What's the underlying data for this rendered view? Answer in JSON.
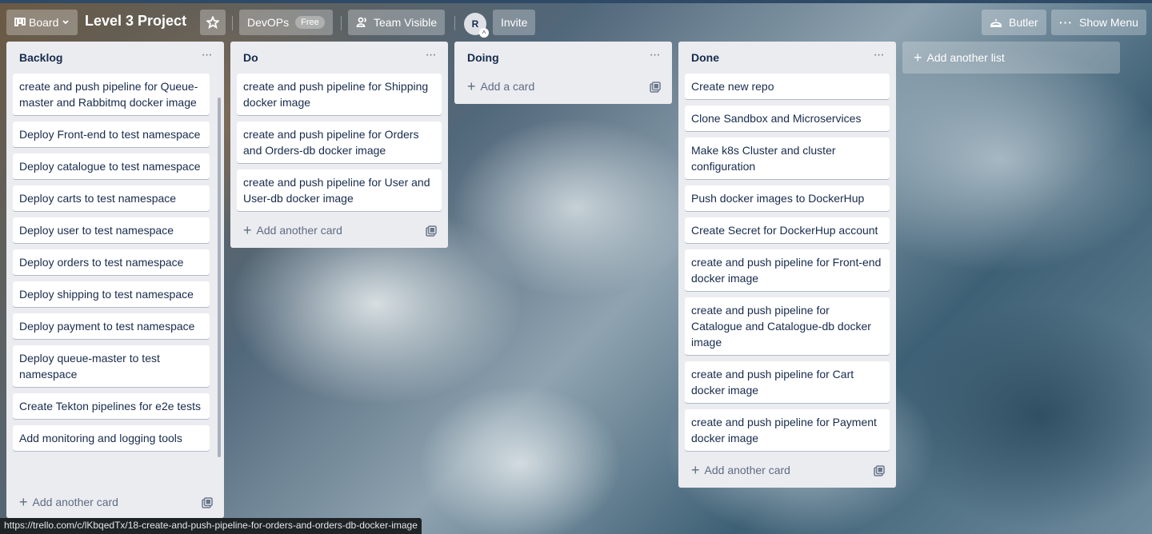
{
  "header": {
    "board_button": "Board",
    "board_title": "Level 3 Project",
    "team_name": "DevOPs",
    "team_plan": "Free",
    "visibility": "Team Visible",
    "avatar_initial": "R",
    "invite": "Invite",
    "butler": "Butler",
    "show_menu": "Show Menu"
  },
  "lists": [
    {
      "title": "Backlog",
      "cards": [
        "create and push pipeline for Queue-master and Rabbitmq docker image",
        "Deploy Front-end to test namespace",
        "Deploy catalogue to test namespace",
        "Deploy carts to test namespace",
        "Deploy user to test namespace",
        "Deploy orders to test namespace",
        "Deploy shipping to test namespace",
        "Deploy payment to test namespace",
        "Deploy queue-master to test namespace",
        "Create Tekton pipelines for e2e tests",
        "Add monitoring and logging tools"
      ],
      "add_label": "Add another card"
    },
    {
      "title": "Do",
      "cards": [
        "create and push pipeline for Shipping docker image",
        "create and push pipeline for Orders and Orders-db docker image",
        "create and push pipeline for User and User-db docker image"
      ],
      "add_label": "Add another card"
    },
    {
      "title": "Doing",
      "cards": [],
      "add_label": "Add a card"
    },
    {
      "title": "Done",
      "cards": [
        "Create new repo",
        "Clone Sandbox and Microservices",
        "Make k8s Cluster and cluster configuration",
        "Push docker images to DockerHup",
        "Create Secret for DockerHup account",
        "create and push pipeline for Front-end docker image",
        "create and push pipeline for Catalogue and Catalogue-db docker image",
        "create and push pipeline for Cart docker image",
        "create and push pipeline for Payment docker image"
      ],
      "add_label": "Add another card"
    }
  ],
  "add_list": "Add another list",
  "status_url": "https://trello.com/c/lKbqedTx/18-create-and-push-pipeline-for-orders-and-orders-db-docker-image"
}
